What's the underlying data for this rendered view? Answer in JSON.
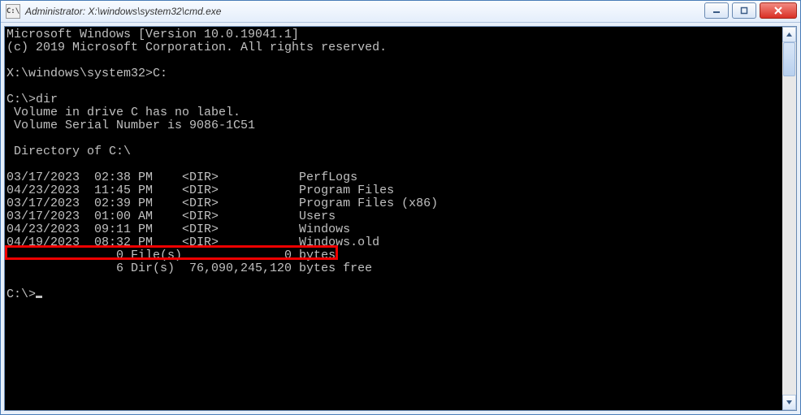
{
  "window": {
    "icon_text": "C:\\",
    "title": "Administrator: X:\\windows\\system32\\cmd.exe"
  },
  "console": {
    "version_line": "Microsoft Windows [Version 10.0.19041.1]",
    "copyright_line": "(c) 2019 Microsoft Corporation. All rights reserved.",
    "prompt1": "X:\\windows\\system32>C:",
    "prompt2": "C:\\>dir",
    "vol_line": " Volume in drive C has no label.",
    "serial_line": " Volume Serial Number is 9086-1C51",
    "dir_of_line": " Directory of C:\\",
    "rows": [
      {
        "date": "03/17/2023",
        "time": "02:38 PM",
        "type": "<DIR>",
        "name": "PerfLogs"
      },
      {
        "date": "04/23/2023",
        "time": "11:45 PM",
        "type": "<DIR>",
        "name": "Program Files"
      },
      {
        "date": "03/17/2023",
        "time": "02:39 PM",
        "type": "<DIR>",
        "name": "Program Files (x86)"
      },
      {
        "date": "03/17/2023",
        "time": "01:00 AM",
        "type": "<DIR>",
        "name": "Users"
      },
      {
        "date": "04/23/2023",
        "time": "09:11 PM",
        "type": "<DIR>",
        "name": "Windows"
      },
      {
        "date": "04/19/2023",
        "time": "08:32 PM",
        "type": "<DIR>",
        "name": "Windows.old"
      }
    ],
    "summary_files": "               0 File(s)              0 bytes",
    "summary_dirs": "               6 Dir(s)  76,090,245,120 bytes free",
    "prompt3": "C:\\>"
  }
}
